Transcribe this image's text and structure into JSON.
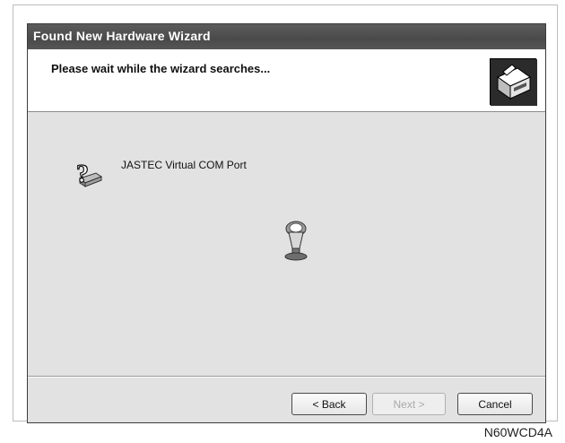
{
  "window": {
    "title": "Found New Hardware Wizard"
  },
  "header": {
    "title": "Please wait while the wizard searches...",
    "icon": "hardware-wizard-icon"
  },
  "device": {
    "icon": "question-mark-device-icon",
    "name": "JASTEC Virtual COM Port"
  },
  "search": {
    "icon": "searching-flashlight-icon"
  },
  "buttons": {
    "back": "< Back",
    "next": "Next >",
    "cancel": "Cancel"
  },
  "caption": "N60WCD4A"
}
